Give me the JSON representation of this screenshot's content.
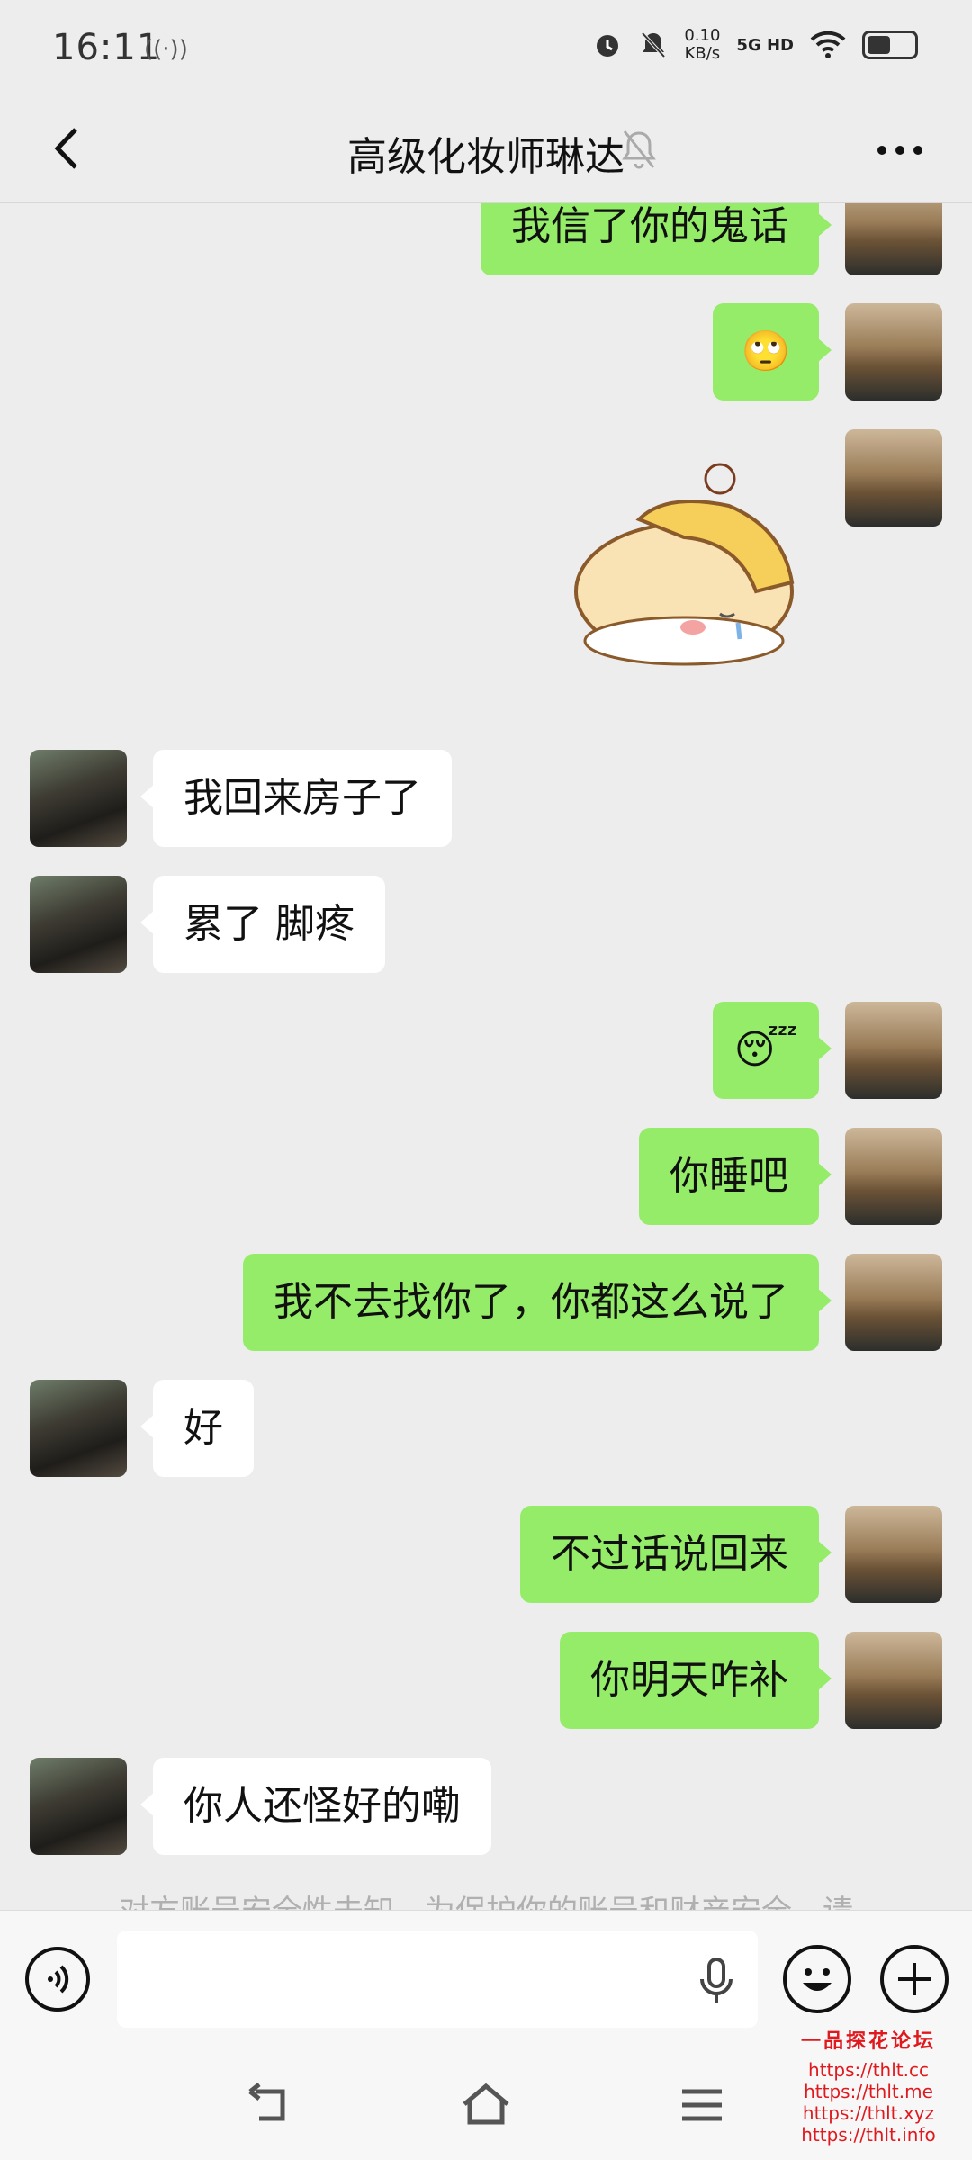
{
  "status_bar": {
    "time": "16:11",
    "net_speed_value": "0.10",
    "net_speed_unit": "KB/s",
    "network": "5G HD",
    "battery_level": 0.55
  },
  "header": {
    "title": "高级化妆师琳达",
    "muted": true
  },
  "messages": [
    {
      "sender": "me",
      "type": "text",
      "text": "我信了你的鬼话"
    },
    {
      "sender": "me",
      "type": "emoji",
      "text": "🙄"
    },
    {
      "sender": "me",
      "type": "sticker",
      "icon": "sad-hamster-sticker"
    },
    {
      "sender": "her",
      "type": "text",
      "text": "我回来房子了"
    },
    {
      "sender": "her",
      "type": "text",
      "text": "累了 脚疼"
    },
    {
      "sender": "me",
      "type": "emoji",
      "text": "😴"
    },
    {
      "sender": "me",
      "type": "text",
      "text": "你睡吧"
    },
    {
      "sender": "me",
      "type": "text",
      "text": "我不去找你了，你都这么说了"
    },
    {
      "sender": "her",
      "type": "text",
      "text": "好"
    },
    {
      "sender": "me",
      "type": "text",
      "text": "不过话说回来"
    },
    {
      "sender": "me",
      "type": "text",
      "text": "你明天咋补"
    },
    {
      "sender": "her",
      "type": "text",
      "text": "你人还怪好的嘞"
    }
  ],
  "notice": "对方账号安全性未知，为保护你的账号和财产安全，请",
  "input": {
    "value": "",
    "icons": [
      "voice-icon",
      "mic-icon",
      "emoji-icon",
      "plus-icon"
    ]
  },
  "watermark": {
    "title": "一品探花论坛",
    "lines": [
      "https://thlt.cc",
      "https://thlt.me",
      "https://thlt.xyz",
      "https://thlt.info"
    ]
  },
  "nav": [
    "back-icon",
    "home-icon",
    "menu-icon"
  ]
}
